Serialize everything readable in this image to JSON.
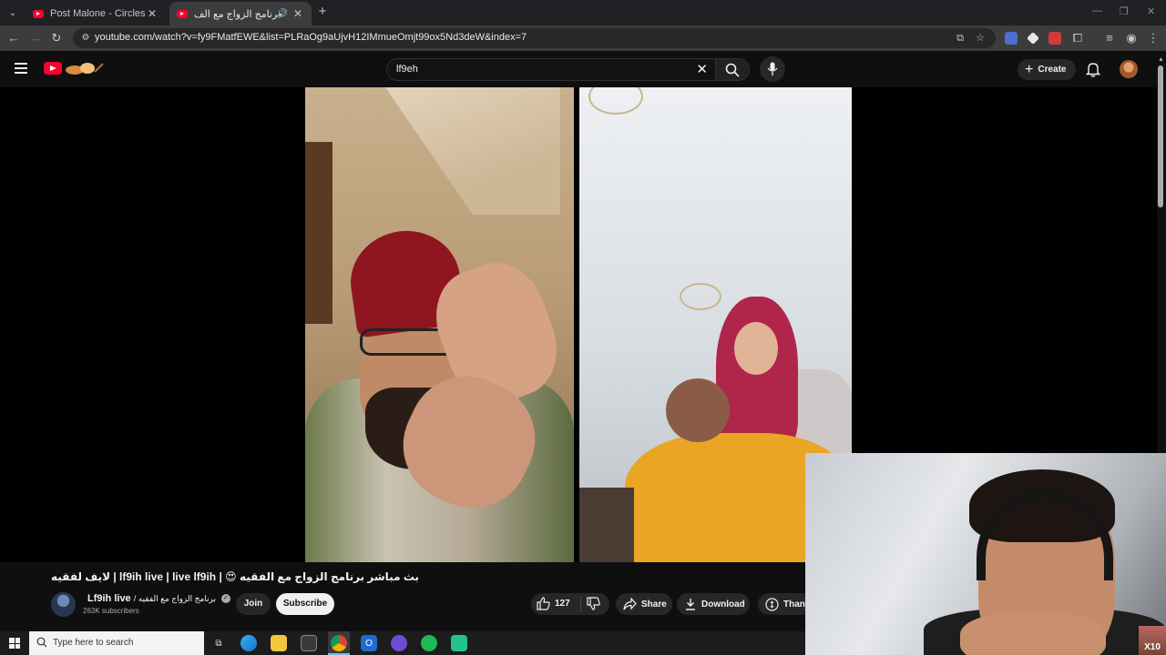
{
  "browser": {
    "tabs": [
      {
        "title": "Post Malone - Circles (Official M",
        "active": false
      },
      {
        "title": "بث مباشر برنامج الزواج مع الف",
        "active": true,
        "audio": true
      }
    ],
    "url": "youtube.com/watch?v=fy9FMatfEWE&list=PLRaOg9aUjvH12IMmueOmjt99ox5Nd3deW&index=7"
  },
  "masthead": {
    "search_value": "lf9eh",
    "create_label": "Create"
  },
  "video": {
    "title": "لايف لفقيه | lf9ih live | live lf9ih | 😍 بث مباشر برنامج الزواج مع الفقيه",
    "channel_name": "Lf9ih live",
    "channel_suffix": "/ برنامج الزواج مع الفقيه",
    "subscribers": "263K subscribers",
    "join_label": "Join",
    "subscribe_label": "Subscribe",
    "like_count": "127",
    "share_label": "Share",
    "download_label": "Download",
    "thanks_label": "Thank"
  },
  "taskbar": {
    "search_placeholder": "Type here to search"
  },
  "webcam": {
    "corner_badge": "X10"
  },
  "colors": {
    "youtube_red": "#ff0033",
    "background": "#0f0f0f",
    "pill_bg": "#272727"
  }
}
